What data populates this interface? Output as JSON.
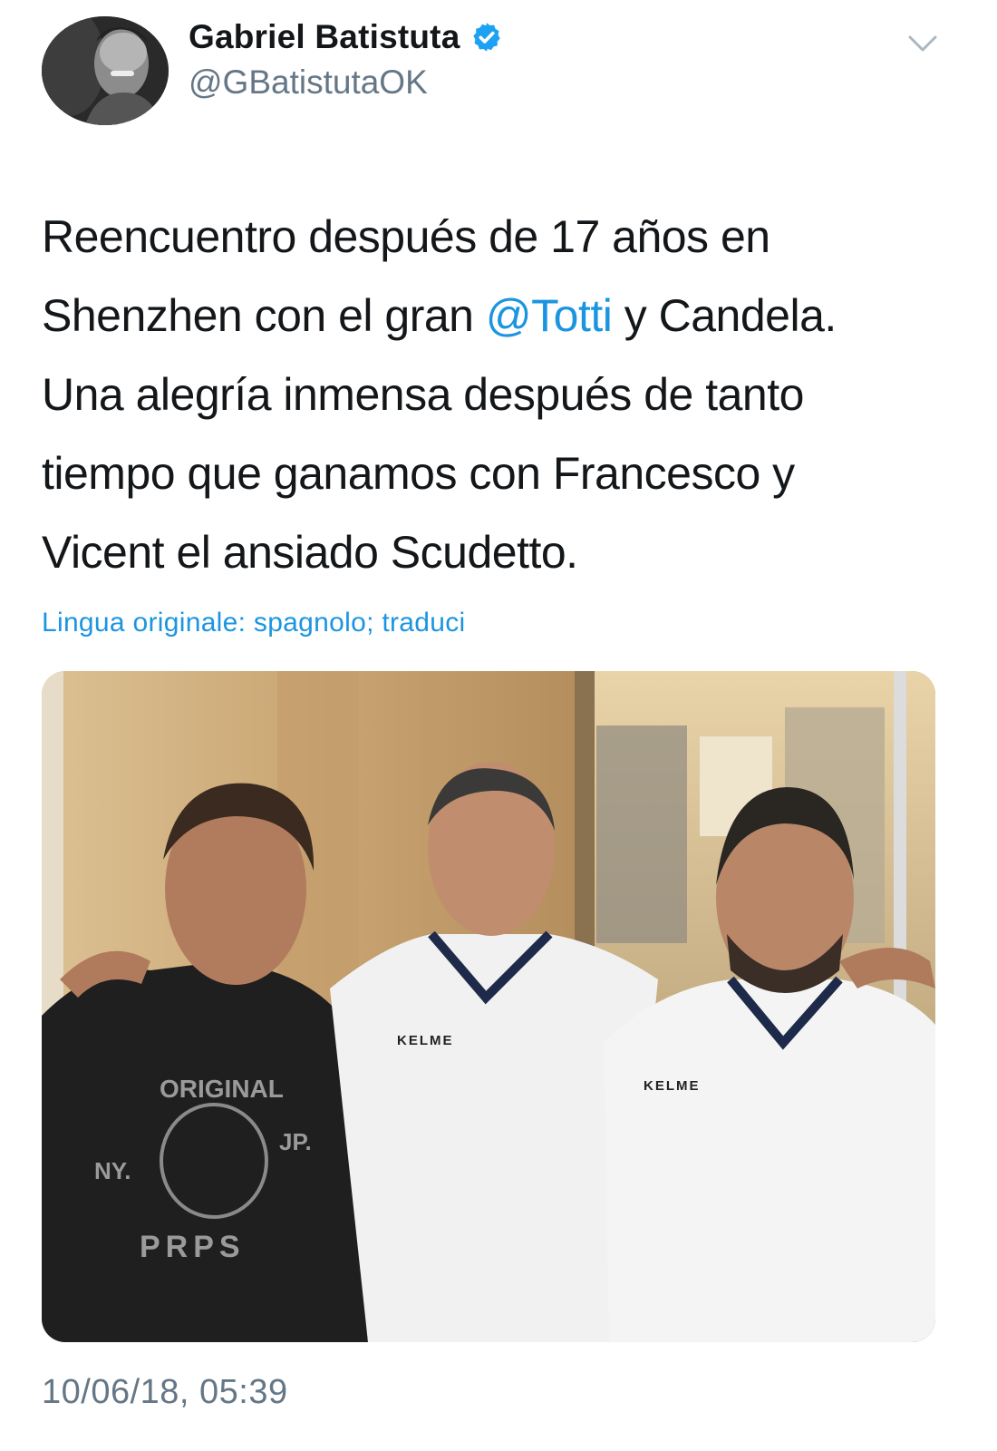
{
  "author": {
    "display_name": "Gabriel Batistuta",
    "handle": "@GBatistutaOK",
    "verified": true,
    "avatar_icon": "profile-photo",
    "verified_icon": "verified-badge-icon",
    "menu_icon": "chevron-down-icon"
  },
  "tweet": {
    "line1": "Reencuentro después de 17 años en",
    "line2_before": "Shenzhen con el gran ",
    "line2_mention": "@Totti",
    "line2_after": " y Candela.",
    "line3": "Una alegría inmensa después de tanto",
    "line4": "tiempo que ganamos con Francesco y",
    "line5": "Vicent el ansiado Scudetto.",
    "translate_text": "Lingua originale: spagnolo; traduci",
    "timestamp": "10/06/18, 05:39"
  },
  "photo": {
    "shirt_logo_center": "KELME",
    "shirt_logo_right": "KELME",
    "tshirt_print_top": "ORIGINAL",
    "tshirt_print_left": "NY.",
    "tshirt_print_right": "JP.",
    "tshirt_print_bottom": "PRPS"
  },
  "colors": {
    "link": "#1b95e0",
    "secondary_text": "#657786",
    "primary_text": "#14171a",
    "verified": "#1da1f2"
  }
}
